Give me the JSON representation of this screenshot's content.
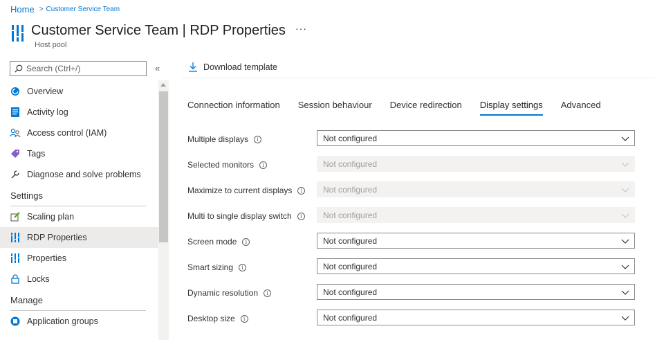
{
  "breadcrumb": {
    "home": "Home",
    "current": "Customer Service Team"
  },
  "header": {
    "title": "Customer Service Team | RDP Properties",
    "subtitle": "Host pool",
    "more": "···"
  },
  "search": {
    "placeholder": "Search (Ctrl+/)"
  },
  "collapse": "«",
  "nav": {
    "items_top": [
      {
        "label": "Overview",
        "icon": "overview-icon"
      },
      {
        "label": "Activity log",
        "icon": "activity-log-icon"
      },
      {
        "label": "Access control (IAM)",
        "icon": "people-icon"
      },
      {
        "label": "Tags",
        "icon": "tag-icon"
      },
      {
        "label": "Diagnose and solve problems",
        "icon": "wrench-icon"
      }
    ],
    "settings_title": "Settings",
    "settings_items": [
      {
        "label": "Scaling plan",
        "icon": "edit-icon"
      },
      {
        "label": "RDP Properties",
        "icon": "host-pool-icon",
        "active": true
      },
      {
        "label": "Properties",
        "icon": "host-pool-icon"
      },
      {
        "label": "Locks",
        "icon": "lock-icon"
      }
    ],
    "manage_title": "Manage",
    "manage_items": [
      {
        "label": "Application groups",
        "icon": "app-group-icon"
      }
    ]
  },
  "toolbar": {
    "download_label": "Download template"
  },
  "tabs": [
    {
      "label": "Connection information"
    },
    {
      "label": "Session behaviour"
    },
    {
      "label": "Device redirection"
    },
    {
      "label": "Display settings",
      "active": true
    },
    {
      "label": "Advanced"
    }
  ],
  "form": {
    "rows": [
      {
        "label": "Multiple displays",
        "value": "Not configured",
        "disabled": false
      },
      {
        "label": "Selected monitors",
        "value": "Not configured",
        "disabled": true
      },
      {
        "label": "Maximize to current displays",
        "value": "Not configured",
        "disabled": true
      },
      {
        "label": "Multi to single display switch",
        "value": "Not configured",
        "disabled": true
      },
      {
        "label": "Screen mode",
        "value": "Not configured",
        "disabled": false
      },
      {
        "label": "Smart sizing",
        "value": "Not configured",
        "disabled": false
      },
      {
        "label": "Dynamic resolution",
        "value": "Not configured",
        "disabled": false
      },
      {
        "label": "Desktop size",
        "value": "Not configured",
        "disabled": false
      }
    ]
  },
  "colors": {
    "accent": "#0078d4",
    "active_bg": "#edebe9",
    "disabled_bg": "#f3f2f1"
  }
}
